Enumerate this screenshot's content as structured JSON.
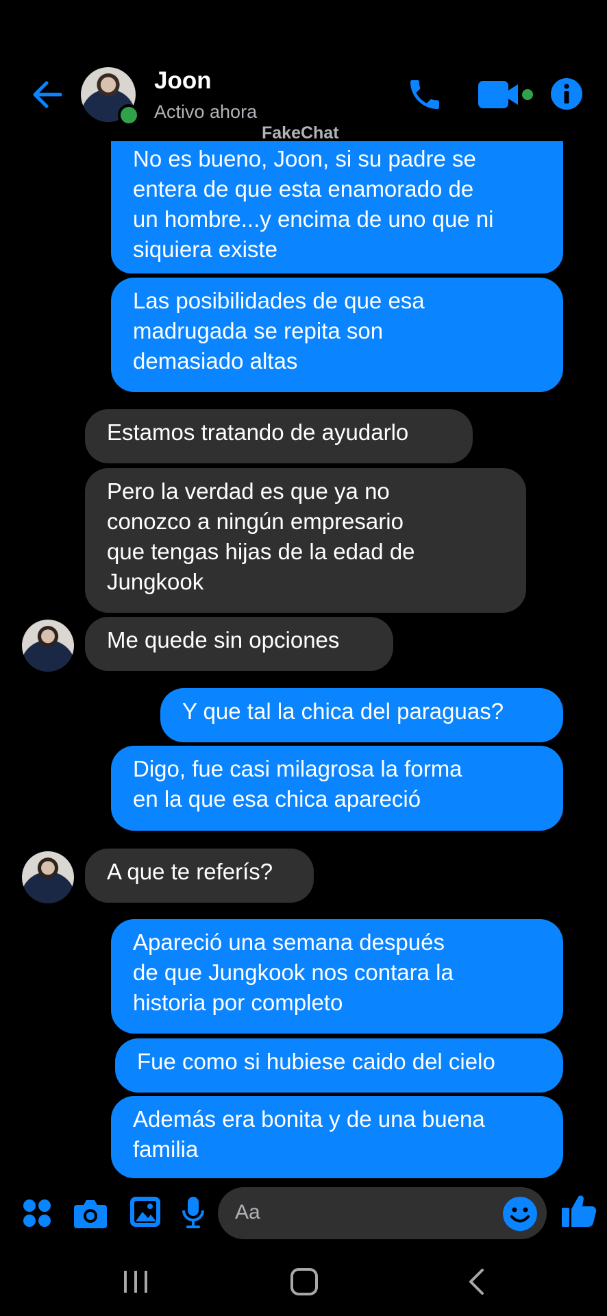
{
  "header": {
    "contact_name": "Joon",
    "status": "Activo ahora",
    "watermark": "FakeChat"
  },
  "colors": {
    "accent": "#0a84ff",
    "incoming_bubble": "#303030",
    "online": "#31a24c",
    "background": "#000000"
  },
  "messages": [
    {
      "dir": "out",
      "text": "No es bueno, Joon, si su padre se\nentera de que esta enamorado de\nun hombre...y encima de uno que ni\nsiquiera existe"
    },
    {
      "dir": "out",
      "text": "Las posibilidades de que esa\nmadrugada se repita son\ndemasiado altas"
    },
    {
      "dir": "in",
      "text": "Estamos tratando de ayudarlo"
    },
    {
      "dir": "in",
      "text": "Pero la verdad es que ya no\nconozco a ningún empresario\nque tengas hijas de la edad de\nJungkook"
    },
    {
      "dir": "in",
      "text": "Me quede sin opciones"
    },
    {
      "dir": "out",
      "text": "Y que tal la chica del paraguas?"
    },
    {
      "dir": "out",
      "text": "Digo, fue casi milagrosa la forma\nen la que esa chica apareció"
    },
    {
      "dir": "in",
      "text": "A que te referís?"
    },
    {
      "dir": "out",
      "text": "Apareció una semana después\nde que Jungkook nos contara la\nhistoria por completo"
    },
    {
      "dir": "out",
      "text": "Fue como si hubiese caido del cielo"
    },
    {
      "dir": "out",
      "text": "Además era bonita y de una buena\nfamilia"
    }
  ],
  "composer": {
    "placeholder": "Aa",
    "icons": [
      "apps-icon",
      "camera-icon",
      "gallery-icon",
      "microphone-icon",
      "emoji-icon",
      "like-icon"
    ]
  },
  "nav": {
    "icons": [
      "recent-apps-icon",
      "home-icon",
      "back-icon"
    ]
  }
}
